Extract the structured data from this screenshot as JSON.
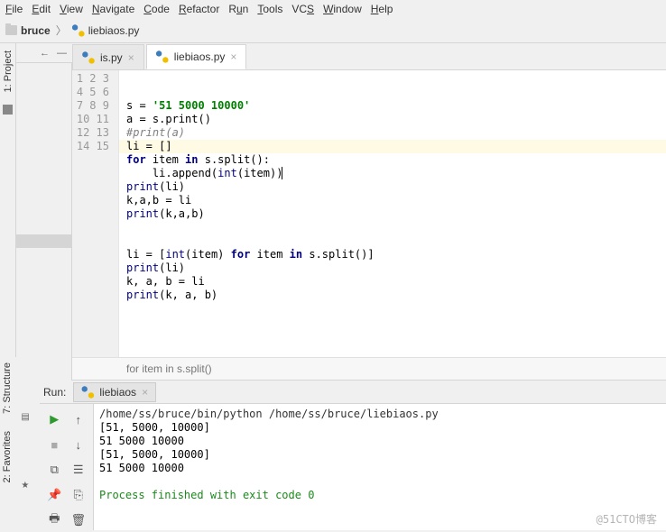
{
  "menu": {
    "file": "File",
    "edit": "Edit",
    "view": "View",
    "navigate": "Navigate",
    "code": "Code",
    "refactor": "Refactor",
    "run": "Run",
    "tools": "Tools",
    "vcs": "VCS",
    "window": "Window",
    "help": "Help"
  },
  "breadcrumb": {
    "folder": "bruce",
    "file": "liebiaos.py"
  },
  "left_tool": {
    "project": "1: Project",
    "structure": "7: Structure",
    "favorites": "2: Favorites"
  },
  "tabs": [
    {
      "label": "is.py",
      "active": false
    },
    {
      "label": "liebiaos.py",
      "active": true
    }
  ],
  "gutter_lines": [
    "1",
    "2",
    "3",
    "4",
    "5",
    "6",
    "7",
    "8",
    "9",
    "10",
    "11",
    "12",
    "13",
    "14",
    "15"
  ],
  "code": {
    "l1_a": "s = ",
    "l1_b": "'51 5000 10000'",
    "l2": "a = s.print()",
    "l3": "#print(a)",
    "l4": "li = []",
    "l5_a": "for",
    "l5_b": " item ",
    "l5_c": "in",
    "l5_d": " s.split():",
    "l6_a": "    li.append(",
    "l6_b": "int",
    "l6_c": "(item))",
    "l7_a": "print",
    "l7_b": "(li)",
    "l8": "k,a,b = li",
    "l9_a": "print",
    "l9_b": "(k,a,b)",
    "l12_a": "li = [",
    "l12_b": "int",
    "l12_c": "(item) ",
    "l12_d": "for",
    "l12_e": " item ",
    "l12_f": "in",
    "l12_g": " s.split()]",
    "l13_a": "print",
    "l13_b": "(li)",
    "l14": "k, a, b = li",
    "l15_a": "print",
    "l15_b": "(k, a, b)"
  },
  "code_crumb": "for item in s.split()",
  "run": {
    "label": "Run:",
    "tab": "liebiaos",
    "cmd": "/home/ss/bruce/bin/python /home/ss/bruce/liebiaos.py",
    "out1": "[51, 5000, 10000]",
    "out2": "51 5000 10000",
    "out3": "[51, 5000, 10000]",
    "out4": "51 5000 10000",
    "exit": "Process finished with exit code 0"
  },
  "watermark": "@51CTO博客"
}
